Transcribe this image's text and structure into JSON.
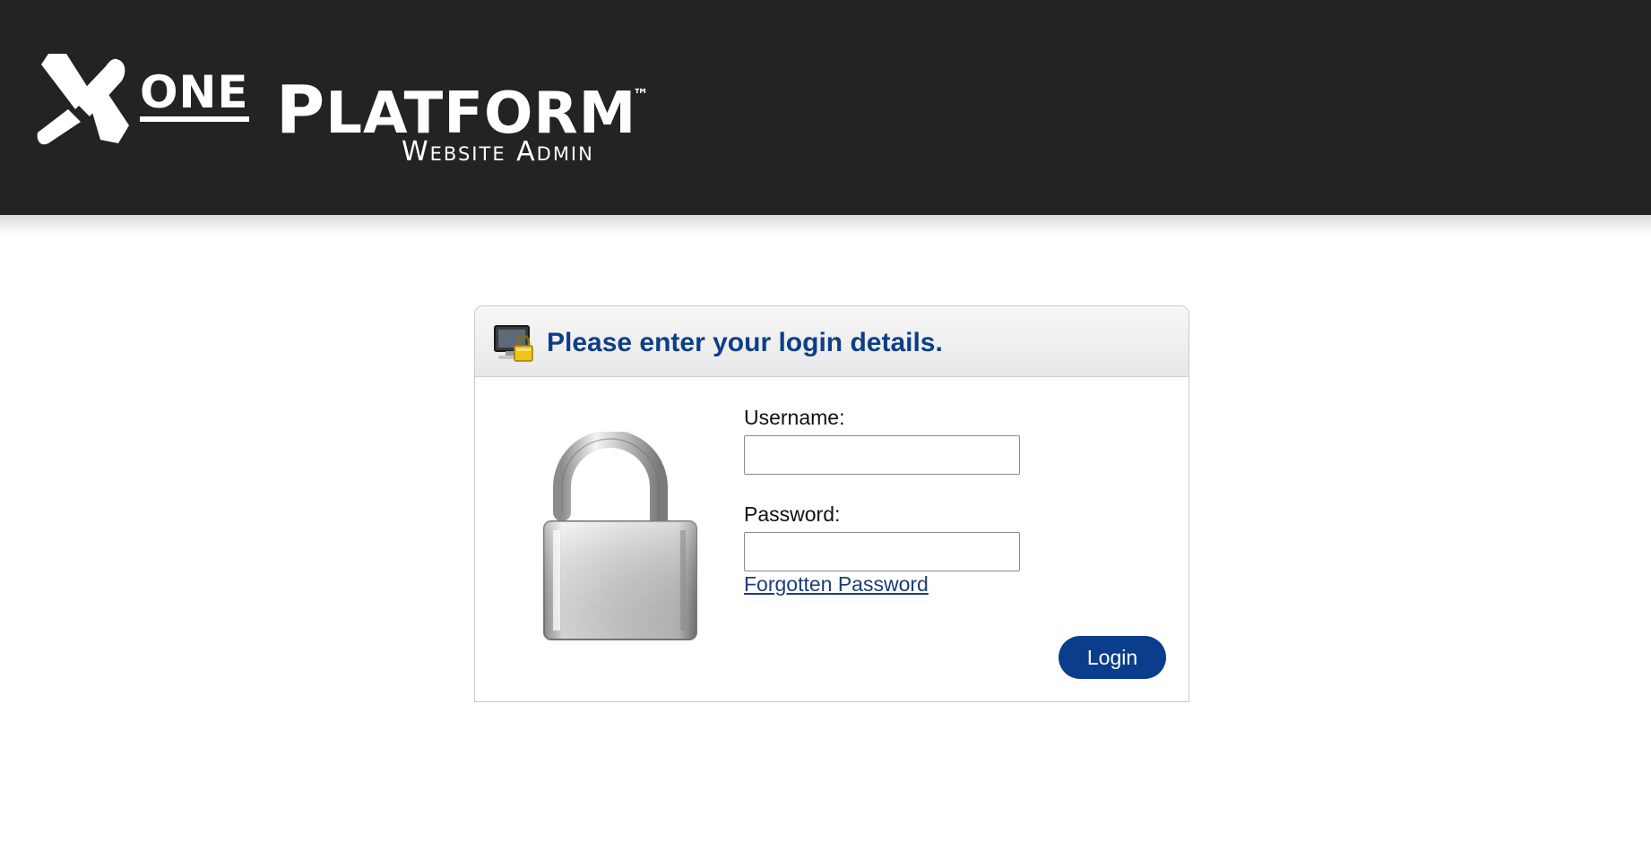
{
  "header": {
    "logo": {
      "one": "ONE",
      "platform_initial": "P",
      "platform_rest": "LATFORM",
      "trademark": "™",
      "subtitle": "Website Admin"
    }
  },
  "login": {
    "title": "Please enter your login details.",
    "username_label": "Username:",
    "username_value": "",
    "password_label": "Password:",
    "password_value": "",
    "forgot_password": "Forgotten Password",
    "submit_label": "Login"
  },
  "icons": {
    "logo_mark": "x-logo-mark-icon",
    "header_icon": "monitor-lock-icon",
    "illustration": "open-padlock-icon"
  },
  "colors": {
    "header_background": "#232323",
    "title_text": "#0c3f86",
    "button_background": "#0a3d8c",
    "link_text": "#1a3d7a"
  }
}
